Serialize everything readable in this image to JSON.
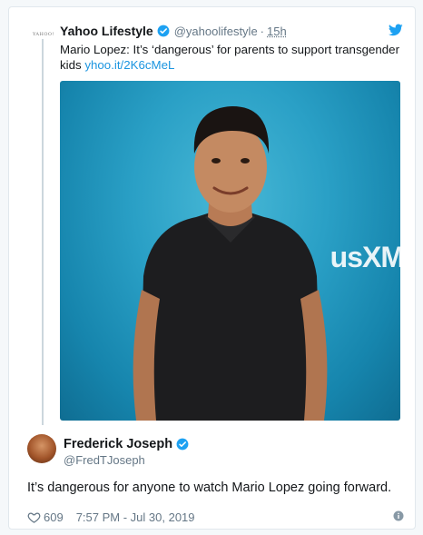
{
  "quoted": {
    "avatar_text": "YAHOO!",
    "name": "Yahoo Lifestyle",
    "handle": "@yahoolifestyle",
    "separator": "·",
    "time": "15h",
    "text": "Mario Lopez: It’s ‘dangerous’ for parents to support transgender kids",
    "link": "yhoo.it/2K6cMeL",
    "photo_brand_text": "usXM"
  },
  "reply": {
    "name": "Frederick Joseph",
    "handle": "@FredTJoseph",
    "text": "It’s dangerous for anyone to watch Mario Lopez going forward.",
    "likes": "609",
    "timestamp": "7:57 PM - Jul 30, 2019"
  },
  "colors": {
    "verified": "#1da1f2",
    "link": "#1b95e0",
    "photo_bg": "#2aa0c6",
    "muted": "#657786"
  },
  "icons": [
    "verified-badge-icon",
    "twitter-bird-icon",
    "heart-icon",
    "info-icon"
  ]
}
